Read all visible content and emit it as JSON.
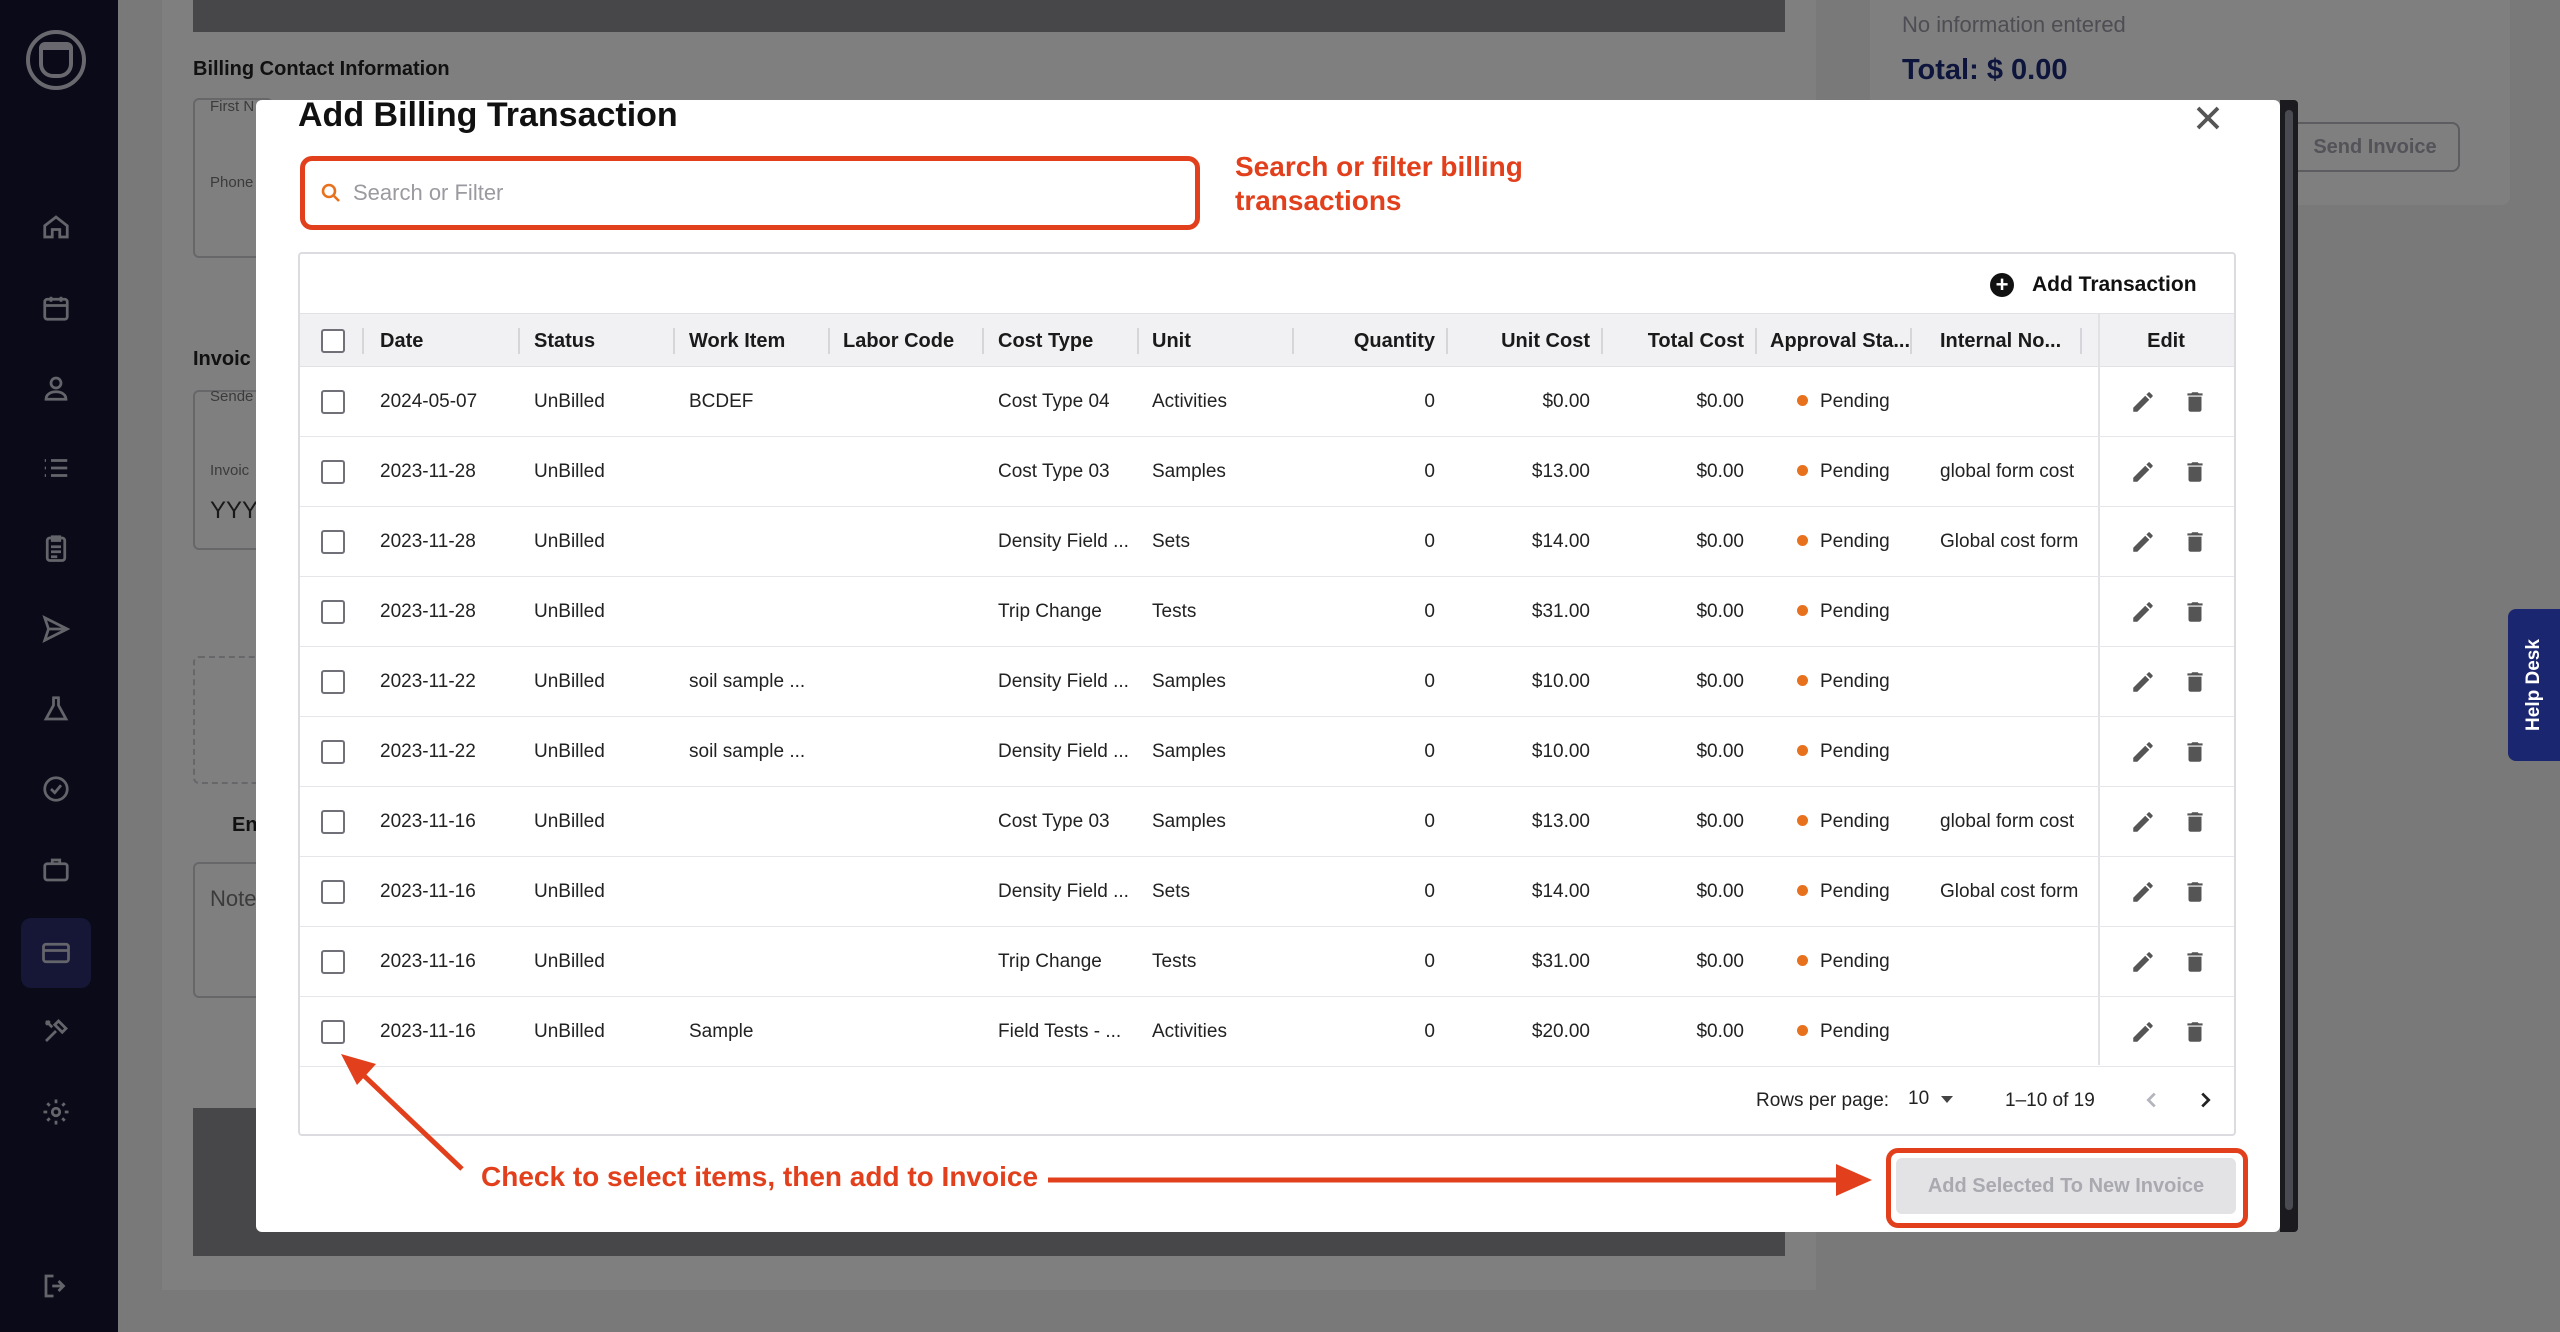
{
  "background": {
    "billing_contact_label": "Billing Contact Information",
    "first_name_label": "First N",
    "phone_label": "Phone",
    "invoice_label": "Invoic",
    "sender_label": "Sende",
    "invoice_date_label": "Invoic",
    "invoice_date_value": "YYY",
    "entry_label": "En",
    "notes_label": "Note",
    "no_info": "No information entered",
    "total": "Total: $ 0.00",
    "send_invoice": "Send Invoice"
  },
  "help_desk": "Help Desk",
  "modal": {
    "title": "Add Billing Transaction",
    "search_placeholder": "Search or Filter",
    "add_transaction": "Add Transaction",
    "add_selected": "Add Selected To New Invoice"
  },
  "annotations": {
    "search_note": [
      "Search or filter billing",
      "transactions"
    ],
    "select_note": "Check to select items, then add to Invoice"
  },
  "table": {
    "columns": [
      "Date",
      "Status",
      "Work Item",
      "Labor Code",
      "Cost Type",
      "Unit",
      "Quantity",
      "Unit Cost",
      "Total Cost",
      "Approval Sta...",
      "Internal No...",
      "Edit"
    ],
    "rows": [
      {
        "date": "2024-05-07",
        "status": "UnBilled",
        "work_item": "BCDEF",
        "labor_code": "",
        "cost_type": "Cost Type 04",
        "unit": "Activities",
        "quantity": "0",
        "unit_cost": "$0.00",
        "total_cost": "$0.00",
        "approval": "Pending",
        "internal": ""
      },
      {
        "date": "2023-11-28",
        "status": "UnBilled",
        "work_item": "",
        "labor_code": "",
        "cost_type": "Cost Type 03",
        "unit": "Samples",
        "quantity": "0",
        "unit_cost": "$13.00",
        "total_cost": "$0.00",
        "approval": "Pending",
        "internal": "global form cost"
      },
      {
        "date": "2023-11-28",
        "status": "UnBilled",
        "work_item": "",
        "labor_code": "",
        "cost_type": "Density Field ...",
        "unit": "Sets",
        "quantity": "0",
        "unit_cost": "$14.00",
        "total_cost": "$0.00",
        "approval": "Pending",
        "internal": "Global cost form"
      },
      {
        "date": "2023-11-28",
        "status": "UnBilled",
        "work_item": "",
        "labor_code": "",
        "cost_type": "Trip Change",
        "unit": "Tests",
        "quantity": "0",
        "unit_cost": "$31.00",
        "total_cost": "$0.00",
        "approval": "Pending",
        "internal": ""
      },
      {
        "date": "2023-11-22",
        "status": "UnBilled",
        "work_item": "soil sample ...",
        "labor_code": "",
        "cost_type": "Density Field ...",
        "unit": "Samples",
        "quantity": "0",
        "unit_cost": "$10.00",
        "total_cost": "$0.00",
        "approval": "Pending",
        "internal": ""
      },
      {
        "date": "2023-11-22",
        "status": "UnBilled",
        "work_item": "soil sample ...",
        "labor_code": "",
        "cost_type": "Density Field ...",
        "unit": "Samples",
        "quantity": "0",
        "unit_cost": "$10.00",
        "total_cost": "$0.00",
        "approval": "Pending",
        "internal": ""
      },
      {
        "date": "2023-11-16",
        "status": "UnBilled",
        "work_item": "",
        "labor_code": "",
        "cost_type": "Cost Type 03",
        "unit": "Samples",
        "quantity": "0",
        "unit_cost": "$13.00",
        "total_cost": "$0.00",
        "approval": "Pending",
        "internal": "global form cost"
      },
      {
        "date": "2023-11-16",
        "status": "UnBilled",
        "work_item": "",
        "labor_code": "",
        "cost_type": "Density Field ...",
        "unit": "Sets",
        "quantity": "0",
        "unit_cost": "$14.00",
        "total_cost": "$0.00",
        "approval": "Pending",
        "internal": "Global cost form"
      },
      {
        "date": "2023-11-16",
        "status": "UnBilled",
        "work_item": "",
        "labor_code": "",
        "cost_type": "Trip Change",
        "unit": "Tests",
        "quantity": "0",
        "unit_cost": "$31.00",
        "total_cost": "$0.00",
        "approval": "Pending",
        "internal": ""
      },
      {
        "date": "2023-11-16",
        "status": "UnBilled",
        "work_item": "Sample",
        "labor_code": "",
        "cost_type": "Field Tests - ...",
        "unit": "Activities",
        "quantity": "0",
        "unit_cost": "$20.00",
        "total_cost": "$0.00",
        "approval": "Pending",
        "internal": ""
      }
    ],
    "rows_per_page_label": "Rows per page:",
    "rows_per_page": "10",
    "range": "1–10 of 19"
  },
  "colors": {
    "sidebar": "#151530",
    "annotation": "#e2401c",
    "pending_dot": "#e8711e",
    "total_text": "#1c2a78"
  },
  "icons": {
    "sidebar": [
      "home-icon",
      "calendar-icon",
      "user-icon",
      "list-icon",
      "clipboard-icon",
      "send-icon",
      "flask-icon",
      "check-badge-icon",
      "briefcase-icon",
      "credit-card-icon",
      "tools-icon",
      "gear-icon",
      "logout-icon"
    ]
  }
}
